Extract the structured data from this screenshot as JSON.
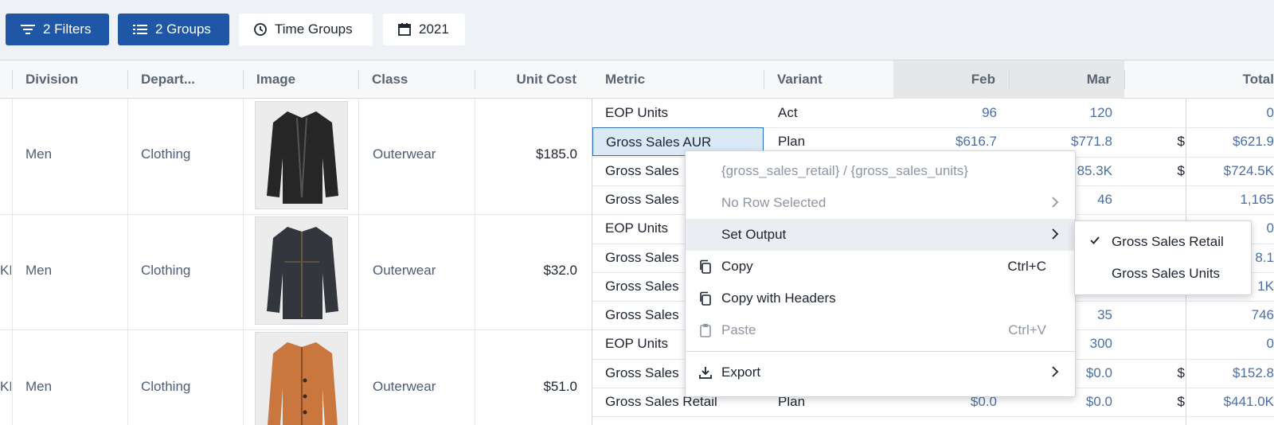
{
  "toolbar": {
    "filters_label": "2 Filters",
    "groups_label": "2 Groups",
    "time_groups_label": "Time Groups",
    "year_label": "2021"
  },
  "columns": {
    "division": "Division",
    "department": "Depart...",
    "image": "Image",
    "class": "Class",
    "unit_cost": "Unit Cost",
    "metric": "Metric",
    "variant": "Variant",
    "feb": "Feb",
    "mar": "Mar",
    "total": "Total"
  },
  "products": [
    {
      "division": "Men",
      "department": "Clothing",
      "class": "Outerwear",
      "unit_cost": "$185.0",
      "image": "black-leather-jacket",
      "color": "#2a2a2a",
      "left_stub": ""
    },
    {
      "division": "Men",
      "department": "Clothing",
      "class": "Outerwear",
      "unit_cost": "$32.0",
      "image": "dark-denim-jacket",
      "color": "#33373d",
      "left_stub": "KE"
    },
    {
      "division": "Men",
      "department": "Clothing",
      "class": "Outerwear",
      "unit_cost": "$51.0",
      "image": "orange-suede-jacket",
      "color": "#c9773f",
      "left_stub": "KE"
    }
  ],
  "metric_rows": [
    {
      "metric": "EOP Units",
      "variant": "Act",
      "feb": "96",
      "mar": "120",
      "extra": "",
      "total": "0"
    },
    {
      "metric": "Gross Sales AUR",
      "variant": "Plan",
      "feb": "$616.7",
      "mar": "$771.8",
      "extra": "$",
      "total": "$621.9"
    },
    {
      "metric": "Gross Sales",
      "variant": "",
      "feb": "",
      "mar": "85.3K",
      "extra": "$",
      "total": "$724.5K"
    },
    {
      "metric": "Gross Sales",
      "variant": "",
      "feb": "",
      "mar": "46",
      "extra": "",
      "total": "1,165"
    },
    {
      "metric": "EOP Units",
      "variant": "",
      "feb": "",
      "mar": "",
      "extra": "",
      "total": "0"
    },
    {
      "metric": "Gross Sales",
      "variant": "",
      "feb": "",
      "mar": "",
      "extra": "",
      "total": "8.1"
    },
    {
      "metric": "Gross Sales",
      "variant": "",
      "feb": "",
      "mar": "",
      "extra": "",
      "total": "1K"
    },
    {
      "metric": "Gross Sales",
      "variant": "",
      "feb": "",
      "mar": "35",
      "extra": "",
      "total": "746"
    },
    {
      "metric": "EOP Units",
      "variant": "",
      "feb": "",
      "mar": "300",
      "extra": "",
      "total": "0"
    },
    {
      "metric": "Gross Sales",
      "variant": "",
      "feb": "",
      "mar": "$0.0",
      "extra": "$",
      "total": "$152.8"
    },
    {
      "metric": "Gross Sales Retail",
      "variant": "Plan",
      "feb": "$0.0",
      "mar": "$0.0",
      "extra": "$",
      "total": "$441.0K"
    }
  ],
  "context_menu": {
    "formula": "{gross_sales_retail} / {gross_sales_units}",
    "no_row": "No Row Selected",
    "set_output": "Set Output",
    "copy": "Copy",
    "copy_shortcut": "Ctrl+C",
    "copy_headers": "Copy with Headers",
    "paste": "Paste",
    "paste_shortcut": "Ctrl+V",
    "export": "Export"
  },
  "submenu": {
    "retail": "Gross Sales Retail",
    "units": "Gross Sales Units"
  },
  "colors": {
    "accent": "#1f57a6",
    "selection": "#dbe9f7",
    "link_number": "#4a6fa5"
  }
}
